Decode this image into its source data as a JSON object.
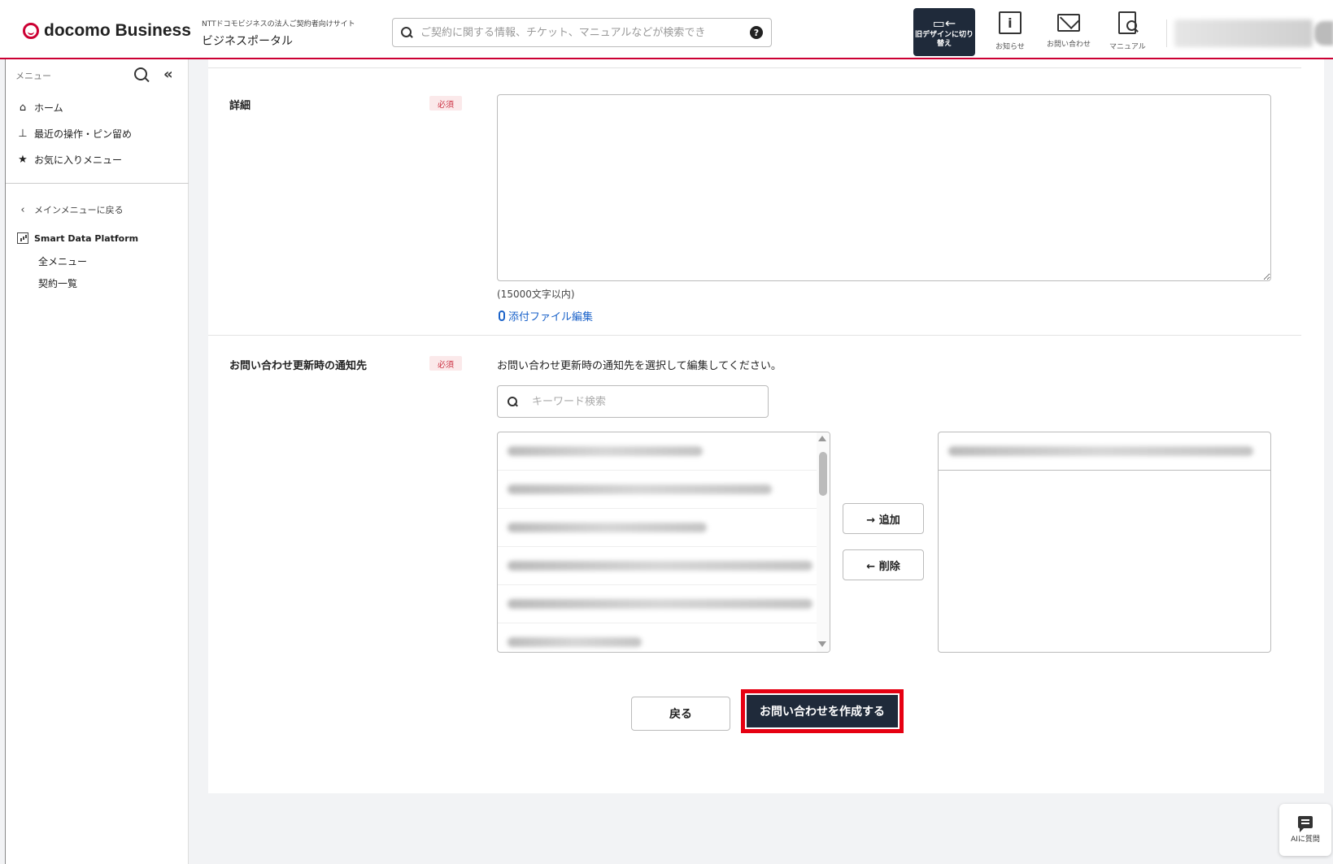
{
  "header": {
    "brand": "docomo Business",
    "site_subtitle": "NTTドコモビジネスの法人ご契約者向けサイト",
    "site_title": "ビジネスポータル",
    "search_placeholder": "ご契約に関する情報、チケット、マニュアルなどが検索でき",
    "switch_label": "旧デザインに切り替え",
    "tools": [
      {
        "label": "お知らせ",
        "icon": "info-icon"
      },
      {
        "label": "お問い合わせ",
        "icon": "mail-icon"
      },
      {
        "label": "マニュアル",
        "icon": "manual-icon"
      }
    ]
  },
  "sidebar": {
    "menu_label": "メニュー",
    "items": [
      {
        "label": "ホーム",
        "icon": "home-icon"
      },
      {
        "label": "最近の操作・ピン留め",
        "icon": "pin-icon"
      },
      {
        "label": "お気に入りメニュー",
        "icon": "star-icon"
      }
    ],
    "back_label": "メインメニューに戻る",
    "service_label": "Smart Data Platform",
    "sub_items": [
      "全メニュー",
      "契約一覧"
    ]
  },
  "form": {
    "detail": {
      "label": "詳細",
      "required": "必須",
      "char_limit": "(15000文字以内)",
      "attach_label": "添付ファイル編集"
    },
    "notify": {
      "label": "お問い合わせ更新時の通知先",
      "required": "必須",
      "instruction": "お問い合わせ更新時の通知先を選択して編集してください。",
      "keyword_placeholder": "キーワード検索",
      "add_label": "→ 追加",
      "remove_label": "← 削除"
    },
    "back_label": "戻る",
    "submit_label": "お問い合わせを作成する"
  },
  "ai": {
    "label": "AIに質問"
  }
}
